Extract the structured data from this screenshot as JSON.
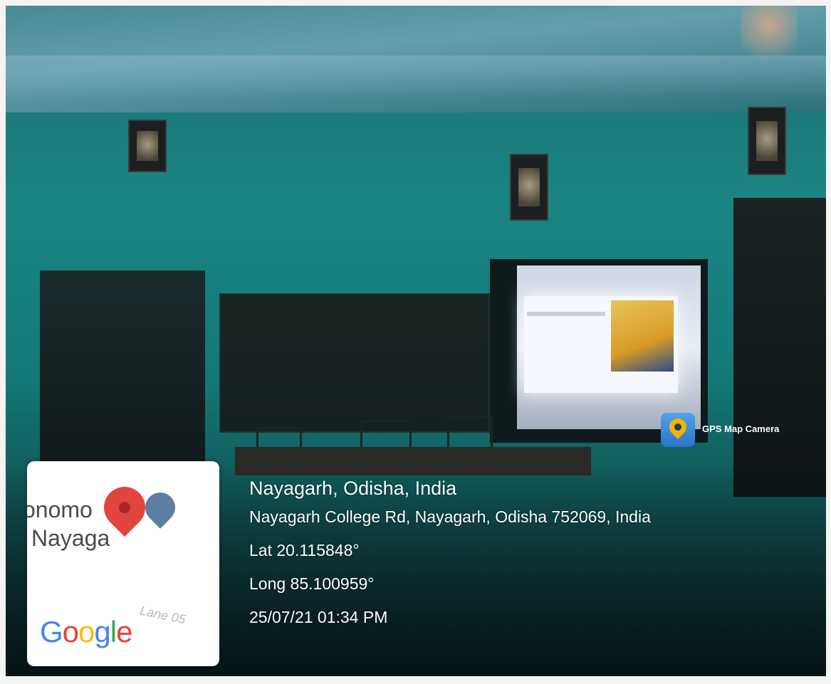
{
  "overlay": {
    "city": "Nayagarh, Odisha, India",
    "address": "Nayagarh College Rd, Nayagarh, Odisha 752069, India",
    "lat": "Lat 20.115848°",
    "long": "Long 85.100959°",
    "datetime": "25/07/21 01:34 PM"
  },
  "app": {
    "name": "GPS Map Camera"
  },
  "map": {
    "label_line1": "onomo",
    "label_line2": "Nayaga",
    "street_label": "Lane 05",
    "provider_logo": "Google",
    "brand_colors": [
      "#4285F4",
      "#EA4335",
      "#FBBC05",
      "#4285F4",
      "#34A853",
      "#EA4335"
    ]
  }
}
